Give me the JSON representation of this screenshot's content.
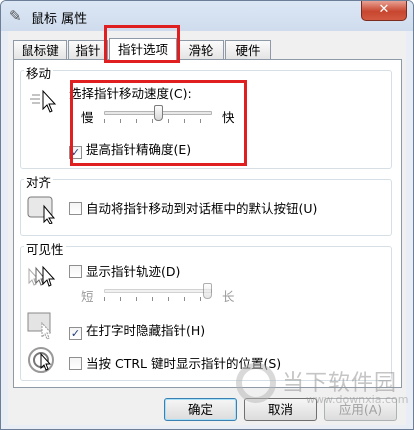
{
  "window": {
    "title": "鼠标 属性",
    "close_label": "✕"
  },
  "tabs": [
    {
      "label": "鼠标键"
    },
    {
      "label": "指针"
    },
    {
      "label": "指针选项"
    },
    {
      "label": "滑轮"
    },
    {
      "label": "硬件"
    }
  ],
  "motion": {
    "group_label": "移动",
    "speed_label": "选择指针移动速度(C):",
    "slow_label": "慢",
    "fast_label": "快",
    "speed_fraction": 0.5,
    "precision_label": "提高指针精确度(E)",
    "precision_checked": true
  },
  "snap": {
    "group_label": "对齐",
    "snap_label": "自动将指针移动到对话框中的默认按钮(U)",
    "snap_checked": false
  },
  "visibility": {
    "group_label": "可见性",
    "trails_label": "显示指针轨迹(D)",
    "trails_checked": false,
    "short_label": "短",
    "long_label": "长",
    "trail_fraction": 1.0,
    "hide_label": "在打字时隐藏指针(H)",
    "hide_checked": true,
    "ctrl_label": "当按 CTRL 键时显示指针的位置(S)",
    "ctrl_checked": false
  },
  "buttons": {
    "ok": "确定",
    "cancel": "取消",
    "apply": "应用(A)"
  },
  "watermark": {
    "text": "当下软件园",
    "url": "www.downxia.com"
  },
  "colors": {
    "highlight": "#e02020",
    "accent": "#3c7fb1"
  }
}
